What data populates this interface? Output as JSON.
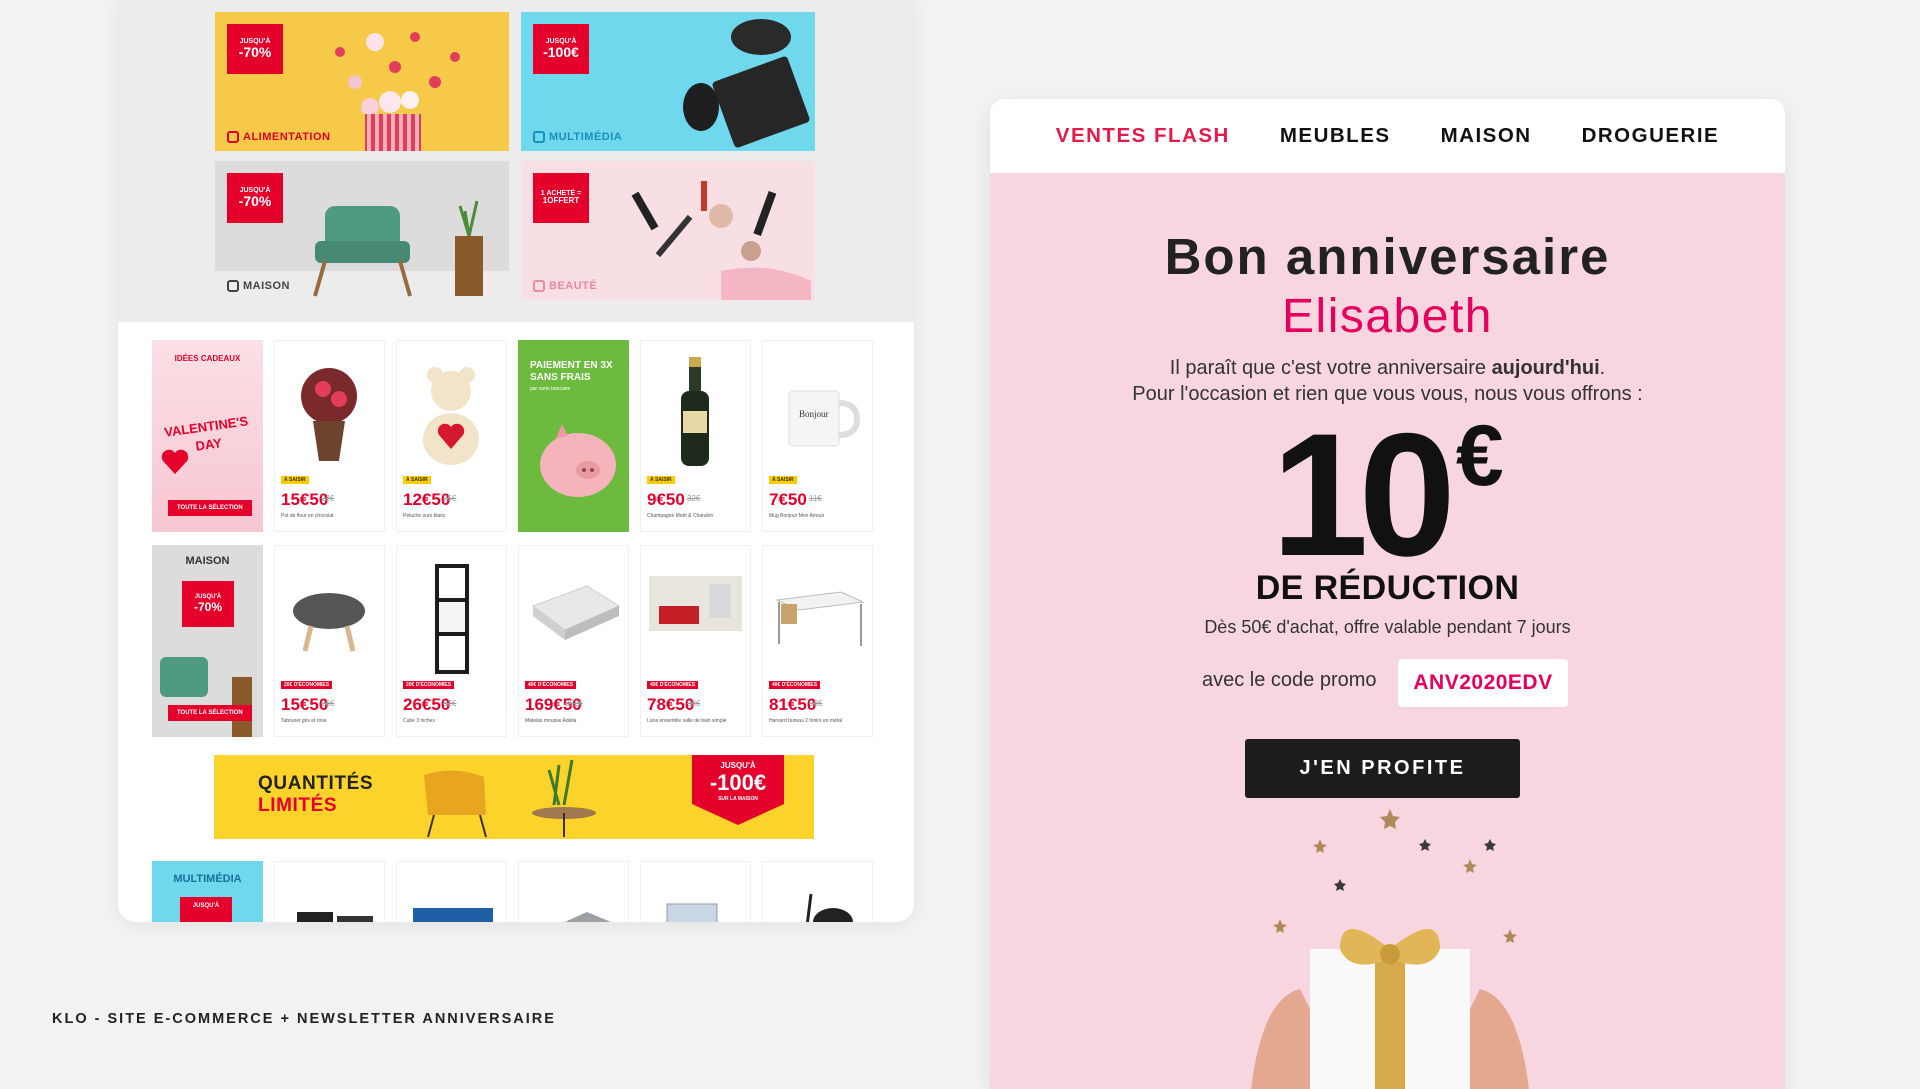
{
  "caption": "KLO - SITE E-COMMERCE + NEWSLETTER ANNIVERSAIRE",
  "site": {
    "tiles": [
      {
        "badge_small": "JUSQU'À",
        "badge_big": "-70%",
        "category": "ALIMENTATION"
      },
      {
        "badge_small": "JUSQU'À",
        "badge_big": "-100€",
        "category": "MULTIMÉDIA"
      },
      {
        "badge_small": "JUSQU'À",
        "badge_big": "-70%",
        "category": "MAISON"
      },
      {
        "badge_small": "1 ACHETÉ =",
        "badge_big": "1OFFERT",
        "category": "BEAUTÉ"
      }
    ],
    "promo_gifts": {
      "title": "IDÉES CADEAUX",
      "headline": "VALENTINE'S DAY",
      "button": "TOUTE LA SÉLECTION"
    },
    "promo_payment": {
      "title": "PAIEMENT EN 3X SANS FRAIS",
      "sub": "par carte bancaire"
    },
    "row1": [
      {
        "tag": "À SAISIR",
        "price": "15€50",
        "old": "22€",
        "desc": "Pot de fleur en chocolat"
      },
      {
        "tag": "À SAISIR",
        "price": "12€50",
        "old": "25€",
        "desc": "Peluche ours blanc"
      },
      {
        "tag": "À SAISIR",
        "price": "9€50",
        "old": "32€",
        "desc": "Champagne Moët & Chandon"
      },
      {
        "tag": "À SAISIR",
        "price": "7€50",
        "old": "11€",
        "desc": "Mug Bonjour Mon Amour"
      }
    ],
    "promo_maison": {
      "title": "MAISON",
      "badge_small": "JUSQU'À",
      "badge_big": "-70%",
      "button": "TOUTE LA SÉLECTION"
    },
    "row2": [
      {
        "tag": "20€ D'ÉCONOMIES",
        "price": "15€50",
        "old": "26€",
        "desc": "Tabouret gris et rose"
      },
      {
        "tag": "20€ D'ÉCONOMIES",
        "price": "26€50",
        "old": "32€",
        "desc": "Cube 3 niches"
      },
      {
        "tag": "40€ D'ÉCONOMIES",
        "price": "169€50",
        "old": "352€",
        "desc": "Matelas mousse Adelia"
      },
      {
        "tag": "40€ D'ÉCONOMIES",
        "price": "78€50",
        "old": "98€",
        "desc": "Luna ensemble salle de bain simple"
      },
      {
        "tag": "40€ D'ÉCONOMIES",
        "price": "81€50",
        "old": "98€",
        "desc": "Harvard bureau 2 tiroirs en métal"
      }
    ],
    "banner": {
      "line1": "QUANTITÉS",
      "line2": "LIMITÉS",
      "badge_small": "JUSQU'À",
      "badge_big": "-100€",
      "badge_sub": "SUR LA MAISON"
    },
    "promo_multimedia": {
      "title": "MULTIMÉDIA",
      "badge_small": "JUSQU'À"
    }
  },
  "email": {
    "nav": [
      "VENTES FLASH",
      "MEUBLES",
      "MAISON",
      "DROGUERIE"
    ],
    "hello": "Bon anniversaire",
    "name": "Elisabeth",
    "msg_line1_pre": "Il paraît que c'est votre anniversaire ",
    "msg_line1_bold": "aujourd'hui",
    "msg_line1_post": ".",
    "msg_line2": "Pour l'occasion et rien que vous vous, nous vous offrons :",
    "amount": "10",
    "currency": "€",
    "reduction": "DE RÉDUCTION",
    "conditions": "Dès 50€ d'achat, offre valable pendant 7 jours",
    "code_label": "avec le code promo",
    "code": "ANV2020EDV",
    "cta": "J'EN PROFITE"
  }
}
